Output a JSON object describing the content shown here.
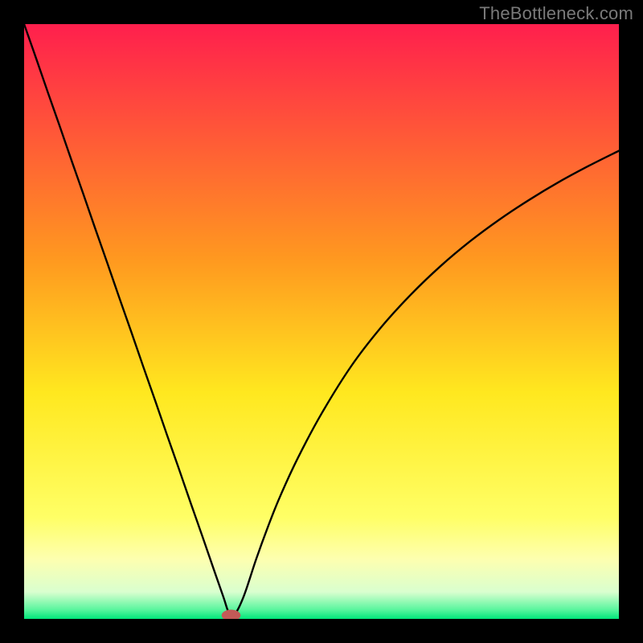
{
  "watermark": "TheBottleneck.com",
  "chart_data": {
    "type": "line",
    "title": "",
    "xlabel": "",
    "ylabel": "",
    "xlim": [
      0,
      100
    ],
    "ylim": [
      0,
      100
    ],
    "series": [
      {
        "name": "curve",
        "x": [
          0,
          2,
          4,
          6,
          8,
          10,
          12,
          14,
          16,
          18,
          20,
          22,
          24,
          26,
          28,
          30,
          32,
          33.5,
          34.5,
          35.5,
          37,
          39,
          41,
          43,
          46,
          50,
          55,
          60,
          65,
          70,
          75,
          80,
          85,
          90,
          95,
          100
        ],
        "y": [
          100,
          94.3,
          88.5,
          82.8,
          77.0,
          71.3,
          65.5,
          59.8,
          54.0,
          48.3,
          42.5,
          36.8,
          31.0,
          25.3,
          19.5,
          13.8,
          8.0,
          3.7,
          0.9,
          0.9,
          4.0,
          10.0,
          15.5,
          20.5,
          27.0,
          34.5,
          42.5,
          49.0,
          54.5,
          59.3,
          63.5,
          67.2,
          70.5,
          73.5,
          76.2,
          78.7
        ]
      }
    ],
    "marker": {
      "x": 34.8,
      "y": 0.6,
      "rx": 1.6,
      "ry": 0.95,
      "color": "#c25a57"
    },
    "gradient_stops": [
      {
        "offset": 0.0,
        "color": "#ff1f4d"
      },
      {
        "offset": 0.4,
        "color": "#ff9a1f"
      },
      {
        "offset": 0.62,
        "color": "#ffe81f"
      },
      {
        "offset": 0.83,
        "color": "#ffff66"
      },
      {
        "offset": 0.9,
        "color": "#fdffb0"
      },
      {
        "offset": 0.955,
        "color": "#d9ffcf"
      },
      {
        "offset": 0.985,
        "color": "#57f59d"
      },
      {
        "offset": 1.0,
        "color": "#00e67a"
      }
    ]
  }
}
